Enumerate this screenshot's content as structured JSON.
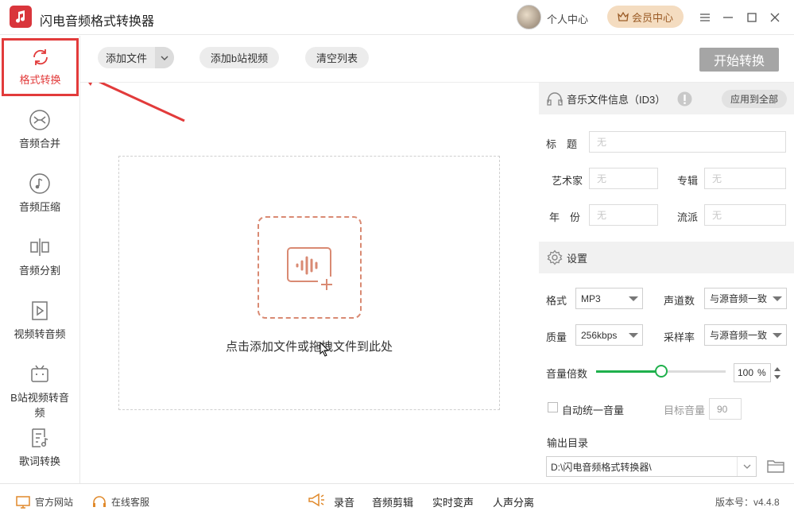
{
  "app": {
    "title": "闪电音频格式转换器"
  },
  "header": {
    "personal_center": "个人中心",
    "vip_center": "会员中心"
  },
  "sidebar": {
    "items": [
      {
        "label": "格式转换",
        "icon": "refresh-icon"
      },
      {
        "label": "音频合并",
        "icon": "merge-icon"
      },
      {
        "label": "音频压缩",
        "icon": "music-note-icon"
      },
      {
        "label": "音频分割",
        "icon": "split-icon"
      },
      {
        "label": "视频转音频",
        "icon": "video-icon"
      },
      {
        "label": "B站视频转音频",
        "icon": "bilibili-icon"
      },
      {
        "label": "歌词转换",
        "icon": "lyrics-icon"
      }
    ]
  },
  "toolbar": {
    "add_file": "添加文件",
    "add_bili": "添加b站视频",
    "clear_list": "清空列表",
    "start": "开始转换"
  },
  "drop": {
    "hint": "点击添加文件或拖拽文件到此处"
  },
  "id3": {
    "title": "音乐文件信息（ID3）",
    "apply_all": "应用到全部",
    "fields": {
      "title_label": "标　题",
      "artist_label": "艺术家",
      "album_label": "专辑",
      "year_label": "年　份",
      "genre_label": "流派",
      "placeholder": "无"
    }
  },
  "settings": {
    "title": "设置",
    "format_label": "格式",
    "format_value": "MP3",
    "channels_label": "声道数",
    "channels_value": "与源音频一致",
    "quality_label": "质量",
    "quality_value": "256kbps",
    "samplerate_label": "采样率",
    "samplerate_value": "与源音频一致",
    "volume_label": "音量倍数",
    "volume_value": "100",
    "volume_unit": "%",
    "volume_fraction": 0.5,
    "auto_normalize_label": "自动统一音量",
    "target_volume_label": "目标音量",
    "target_volume_value": "90",
    "output_dir_label": "输出目录",
    "output_dir_value": "D:\\闪电音频格式转换器\\"
  },
  "footer": {
    "website": "官方网站",
    "support": "在线客服",
    "tools": [
      "录音",
      "音频剪辑",
      "实时变声",
      "人声分离"
    ],
    "version": "版本号：v4.4.8"
  },
  "colors": {
    "accent_red": "#e23b3b",
    "green": "#1fb04c",
    "vip_bg": "#f4dcc0"
  }
}
